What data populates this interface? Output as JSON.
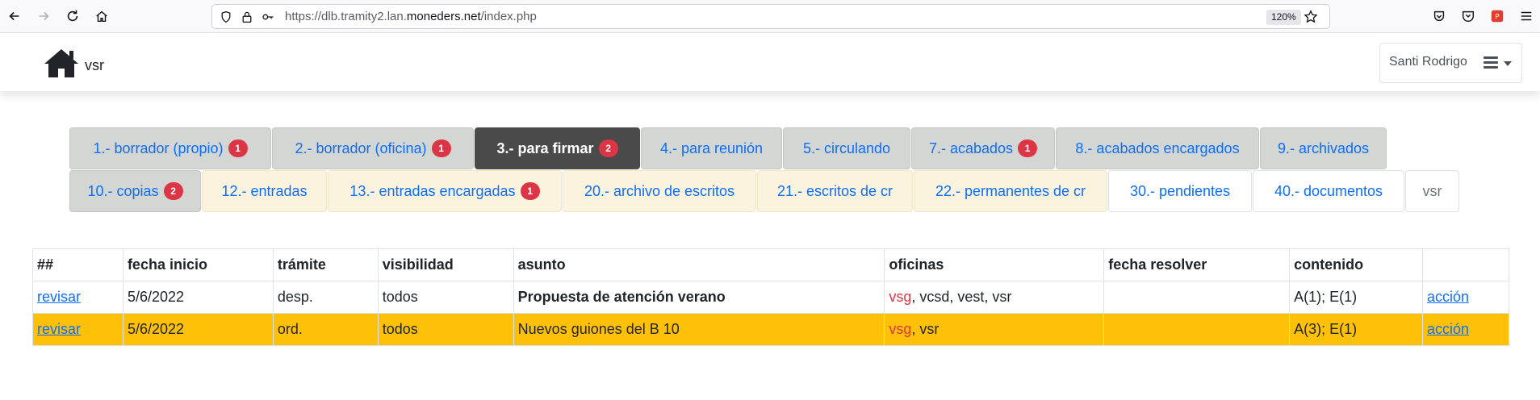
{
  "browser": {
    "url_prefix": "https://dlb.tramity2.lan.",
    "url_host": "moneders.net",
    "url_path": "/index.php",
    "zoom": "120%"
  },
  "navbar": {
    "brand": "vsr",
    "user_name": "Santi Rodrigo"
  },
  "tabs_row1": [
    {
      "label": "1.- borrador (propio)",
      "badge": "1"
    },
    {
      "label": "2.- borrador (oficina)",
      "badge": "1"
    },
    {
      "label": "3.- para firmar",
      "badge": "2"
    },
    {
      "label": "4.- para reunión",
      "badge": ""
    },
    {
      "label": "5.- circulando",
      "badge": ""
    },
    {
      "label": "7.- acabados",
      "badge": "1"
    },
    {
      "label": "8.- acabados encargados",
      "badge": ""
    },
    {
      "label": "9.- archivados",
      "badge": ""
    }
  ],
  "tabs_row2": [
    {
      "label": "10.- copias",
      "badge": "2"
    },
    {
      "label": "12.- entradas",
      "badge": ""
    },
    {
      "label": "13.- entradas encargadas",
      "badge": "1"
    },
    {
      "label": "20.- archivo de escritos",
      "badge": ""
    },
    {
      "label": "21.- escritos de cr",
      "badge": ""
    },
    {
      "label": "22.- permanentes de cr",
      "badge": ""
    },
    {
      "label": "30.- pendientes",
      "badge": ""
    },
    {
      "label": "40.- documentos",
      "badge": ""
    },
    {
      "label": "vsr",
      "badge": ""
    }
  ],
  "table": {
    "headers": [
      "##",
      "fecha inicio",
      "trámite",
      "visibilidad",
      "asunto",
      "oficinas",
      "fecha resolver",
      "contenido",
      ""
    ],
    "rows": [
      {
        "link": "revisar",
        "fecha_inicio": "5/6/2022",
        "tramite": "desp.",
        "visibilidad": "todos",
        "asunto": "Propuesta de atención verano",
        "oficina_main": "vsg",
        "oficinas_rest": ", vcsd, vest, vsr",
        "fecha_resolver": "",
        "contenido": "A(1); E(1)",
        "accion": "acción"
      },
      {
        "link": "revisar",
        "fecha_inicio": "5/6/2022",
        "tramite": "ord.",
        "visibilidad": "todos",
        "asunto": "Nuevos guiones del B 10",
        "oficina_main": "vsg",
        "oficinas_rest": ", vsr",
        "fecha_resolver": "",
        "contenido": "A(3); E(1)",
        "accion": "acción"
      }
    ]
  },
  "colors": {
    "accent": "#0d6efd",
    "badge": "#dc3545",
    "highlight_row": "#ffc107",
    "active_tab": "#4a4a4a"
  }
}
